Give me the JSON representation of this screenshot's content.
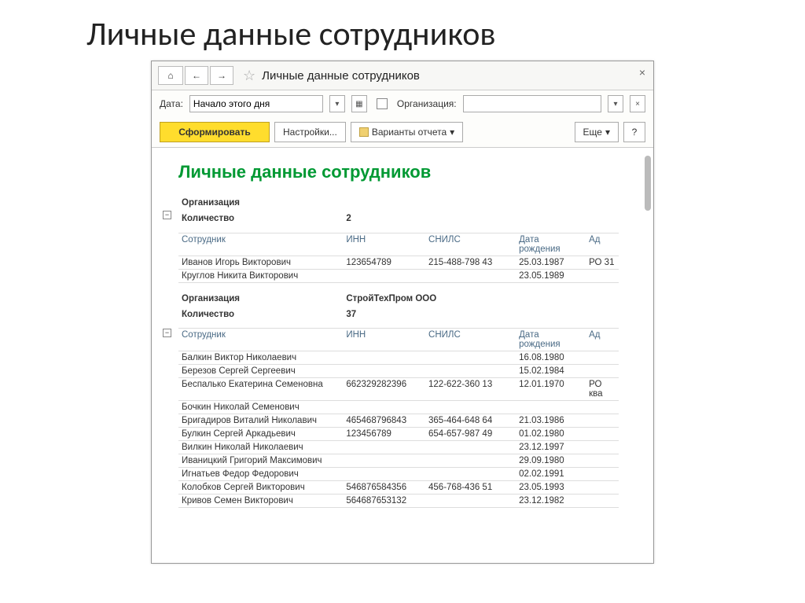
{
  "slide_title": "Личные данные сотрудников",
  "window": {
    "title": "Личные данные сотрудников",
    "close": "×"
  },
  "filter": {
    "date_label": "Дата:",
    "date_value": "Начало этого дня",
    "org_label": "Организация:",
    "dropdown": "▾",
    "clear": "×",
    "calendar": "▦"
  },
  "toolbar": {
    "generate": "Сформировать",
    "settings": "Настройки...",
    "variants": "Варианты отчета",
    "more": "Еще",
    "help": "?"
  },
  "report": {
    "title": "Личные данные сотрудников",
    "org_label": "Организация",
    "count_label": "Количество",
    "headers": {
      "employee": "Сотрудник",
      "inn": "ИНН",
      "snils": "СНИЛС",
      "dob": "Дата рождения",
      "addr": "Ад"
    },
    "groups": [
      {
        "org_value": "",
        "count_value": "2",
        "rows": [
          {
            "emp": "Иванов Игорь Викторович",
            "inn": "123654789",
            "snils": "215-488-798 43",
            "dob": "25.03.1987",
            "addr": "РО 31"
          },
          {
            "emp": "Круглов Никита Викторович",
            "inn": "",
            "snils": "",
            "dob": "23.05.1989",
            "addr": ""
          }
        ]
      },
      {
        "org_value": "СтройТехПром ООО",
        "count_value": "37",
        "rows": [
          {
            "emp": "Балкин Виктор Николаевич",
            "inn": "",
            "snils": "",
            "dob": "16.08.1980",
            "addr": ""
          },
          {
            "emp": "Березов Сергей Сергеевич",
            "inn": "",
            "snils": "",
            "dob": "15.02.1984",
            "addr": ""
          },
          {
            "emp": "Беспалько Екатерина Семеновна",
            "inn": "662329282396",
            "snils": "122-622-360 13",
            "dob": "12.01.1970",
            "addr": "РО ква"
          },
          {
            "emp": "Бочкин Николай Семенович",
            "inn": "",
            "snils": "",
            "dob": "",
            "addr": ""
          },
          {
            "emp": "Бригадиров Виталий Николавич",
            "inn": "465468796843",
            "snils": "365-464-648 64",
            "dob": "21.03.1986",
            "addr": ""
          },
          {
            "emp": "Булкин Сергей Аркадьевич",
            "inn": "123456789",
            "snils": "654-657-987 49",
            "dob": "01.02.1980",
            "addr": ""
          },
          {
            "emp": "Вилкин Николай Николаевич",
            "inn": "",
            "snils": "",
            "dob": "23.12.1997",
            "addr": ""
          },
          {
            "emp": "Иваницкий Григорий Максимович",
            "inn": "",
            "snils": "",
            "dob": "29.09.1980",
            "addr": ""
          },
          {
            "emp": "Игнатьев Федор Федорович",
            "inn": "",
            "snils": "",
            "dob": "02.02.1991",
            "addr": ""
          },
          {
            "emp": "Колобков Сергей Викторович",
            "inn": "546876584356",
            "snils": "456-768-436 51",
            "dob": "23.05.1993",
            "addr": ""
          },
          {
            "emp": "Кривов Семен Викторович",
            "inn": "564687653132",
            "snils": "",
            "dob": "23.12.1982",
            "addr": ""
          }
        ]
      }
    ]
  }
}
